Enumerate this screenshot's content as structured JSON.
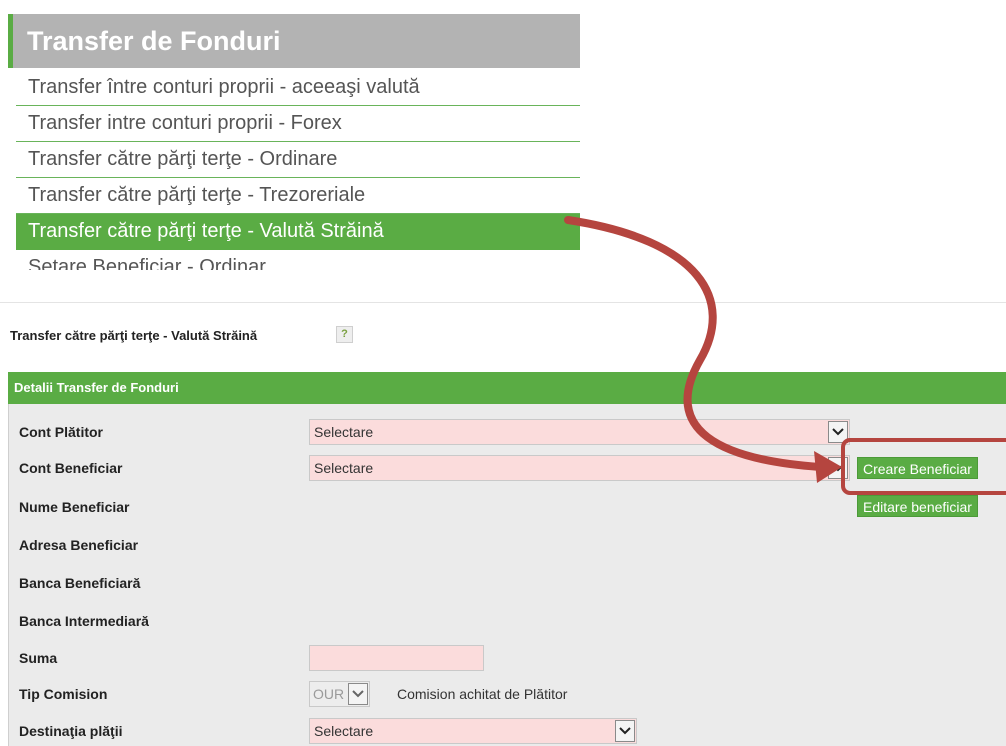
{
  "menu": {
    "title": "Transfer de Fonduri",
    "items": [
      {
        "label": "Transfer între conturi proprii - aceeaşi valută",
        "active": false
      },
      {
        "label": "Transfer intre conturi proprii - Forex",
        "active": false
      },
      {
        "label": "Transfer către părţi terţe - Ordinare",
        "active": false
      },
      {
        "label": "Transfer către părţi terţe - Trezoreriale",
        "active": false
      },
      {
        "label": "Transfer către părţi terţe - Valută Străină",
        "active": true
      },
      {
        "label": "Setare Beneficiar - Ordinar",
        "active": false
      }
    ]
  },
  "page": {
    "title": "Transfer către părţi terţe - Valută Străină",
    "help_icon": "?"
  },
  "form": {
    "header": "Detalii Transfer de Fonduri",
    "fields": {
      "cont_platitor": {
        "label": "Cont Plătitor",
        "value": "Selectare"
      },
      "cont_beneficiar": {
        "label": "Cont Beneficiar",
        "value": "Selectare"
      },
      "nume_beneficiar": {
        "label": "Nume Beneficiar"
      },
      "adresa_beneficiar": {
        "label": "Adresa Beneficiar"
      },
      "banca_beneficiara": {
        "label": "Banca Beneficiară"
      },
      "banca_intermediara": {
        "label": "Banca Intermediară"
      },
      "suma": {
        "label": "Suma",
        "value": ""
      },
      "tip_comision": {
        "label": "Tip Comision",
        "value": "OUR",
        "note": "Comision achitat de Plătitor"
      },
      "destinatia_platii": {
        "label": "Destinaţia plăţii",
        "value": "Selectare"
      }
    },
    "buttons": {
      "creare_beneficiar": "Creare Beneficiar",
      "editare_beneficiar": "Editare beneficiar"
    }
  },
  "colors": {
    "accent_green": "#5aac44",
    "menu_header_gray": "#b3b3b3",
    "required_field_pink": "#fbdcdc",
    "annotation_red": "#b5453f"
  },
  "icons": {
    "dropdown": "chevron-down-icon",
    "help": "question-mark-icon",
    "annotation": "curved-arrow-icon"
  }
}
